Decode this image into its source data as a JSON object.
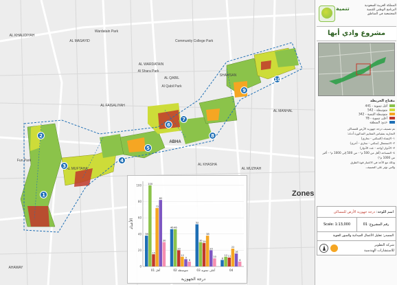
{
  "header": {
    "org_name_line1": "المملكة العربية السعودية",
    "org_name_line2": "البرنامج الوطني للتنمية",
    "org_name_line3": "المجتمعية في المناطق",
    "logo_text": "تنمية",
    "project_title": "مشروع وادي أبها"
  },
  "legend": {
    "title": "مفتاح الخريطة",
    "items": [
      {
        "label": "أقل تنموية - 441",
        "color": "#8bc34a"
      },
      {
        "label": "متوسطة - 542",
        "color": "#cddc39"
      },
      {
        "label": "متوسطة التنمية - 342",
        "color": "#f5a623"
      },
      {
        "label": "أعلى تنموية - 78",
        "color": "#c0392b"
      },
      {
        "label": "حدود المنطقة",
        "color": "#1f6fb5"
      }
    ],
    "notes": [
      "تم تصنيف درجة جهوزية الأرض للمساكن",
      "التجارية بمقياس المعايير المذكورة أدناه:",
      "١- الإنشاء (السكني - تجاري)",
      "٢- الاستعمال (سكني - تجاري - أخرى)",
      "٣- الأدوار (واحد - عدد الأدوار)",
      "٤- المساحة (أقل من 500 م² - من 500 إلى 1000 م² - أكبر من 1000 م²)",
      "وذلك مع الأخذ في الاعتبار قوة الطرق",
      "والتي تؤثر على التصنيف."
    ]
  },
  "info": {
    "sheet_label": "اسم اللوحة:",
    "sheet_name": "درجة جهوزية الأرض للمساكن",
    "scale_label": "Scale: 1:13,000",
    "sheet_no_label": "رقم المشروع:",
    "sheet_no": "01",
    "source": "المصدر: تحليل الأعمال الميدانية والصور الجوية",
    "company_line1": "شركة التطوير",
    "company_line2": "للاستشارات الهندسية"
  },
  "map": {
    "zones_label": "Zones",
    "zone_numbers": [
      "1",
      "2",
      "3",
      "4",
      "5",
      "6",
      "7",
      "8",
      "9",
      "10"
    ],
    "street_labels": {
      "al_khalidiyah": "AL KHALIDIYAH",
      "al_masayid": "AL MASAYID",
      "al_wardatain": "AL WARDATAIN",
      "al_qabil": "AL QABIL",
      "al_faisaliyah": "AL FAISALIYAH",
      "shamsan": "SHAMSAN",
      "al_manhal": "AL MANHAL",
      "al_khasha": "AL KHASHA",
      "al_muzhah": "AL MUZHAH",
      "al_muftaha": "AL MUFTAHA",
      "abha": "ABHA",
      "ahaway": "AHAWAY",
      "wardatain_park": "Wardatain Park",
      "al_qabil_park": "Al Qabil Park",
      "al_shara_park": "Al Shara Park",
      "community_college": "Community College Park",
      "fun_park": "Fun Park"
    }
  },
  "chart_data": {
    "type": "bar",
    "title": "",
    "xlabel": "درجة الجهوزية",
    "ylabel": "الأعداد",
    "ylim": [
      0,
      105
    ],
    "categories": [
      "أقل 01",
      "متوسطة 02",
      "أعلى تنموية 03",
      "04"
    ],
    "category_labels": [
      "أقل 01",
      "متوسطة 02",
      "أعلى تنموية 03",
      "04"
    ],
    "series": [
      {
        "color": "#1f6fb5",
        "values": [
          38,
          46,
          52,
          8
        ]
      },
      {
        "color": "#8bc34a",
        "values": [
          100,
          46,
          30,
          12
        ]
      },
      {
        "color": "#c0392b",
        "values": [
          15,
          20,
          29,
          11
        ]
      },
      {
        "color": "#f5a623",
        "values": [
          72,
          12,
          38,
          22
        ]
      },
      {
        "color": "#7e57c2",
        "values": [
          82,
          9,
          20,
          16
        ]
      },
      {
        "color": "#f48fb1",
        "values": [
          30,
          6,
          10,
          6
        ]
      }
    ],
    "data_labels": [
      [
        "38",
        "46",
        "52",
        "8"
      ],
      [
        "100",
        "46",
        "30",
        "12"
      ],
      [
        "15",
        "20",
        "29",
        "11"
      ],
      [
        "72",
        "12",
        "38",
        "22"
      ],
      [
        "82",
        "9",
        "20",
        "16"
      ],
      [
        "30",
        "6",
        "10",
        "6"
      ]
    ]
  }
}
